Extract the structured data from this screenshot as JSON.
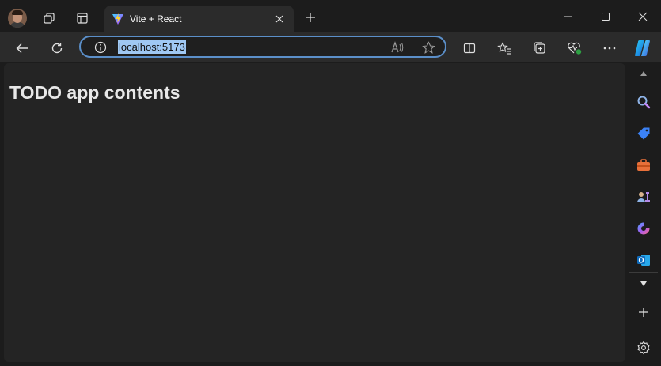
{
  "window": {
    "tab_title": "Vite + React",
    "icons": {
      "profile": "avatar",
      "workspaces": "workspaces-icon",
      "tab_actions": "tab-actions-icon",
      "favicon": "vite-icon",
      "close_tab": "close-icon",
      "new_tab": "plus-icon",
      "minimize": "minimize-icon",
      "maximize": "maximize-icon",
      "close_window": "close-icon"
    }
  },
  "toolbar": {
    "url": "localhost:5173",
    "icons": [
      "back-icon",
      "refresh-icon",
      "info-icon",
      "read-aloud-icon",
      "favorite-star-icon",
      "split-screen-icon",
      "favorites-icon",
      "collections-icon",
      "browser-essentials-icon",
      "more-icon",
      "copilot-icon"
    ]
  },
  "page": {
    "heading": "TODO app contents"
  },
  "sidebar": {
    "icons": [
      "scroll-up-icon",
      "search-icon",
      "shopping-tag-icon",
      "tools-icon",
      "games-icon",
      "microsoft-365-icon",
      "outlook-icon",
      "scroll-down-icon",
      "add-icon",
      "settings-icon"
    ]
  },
  "colors": {
    "accent": "#5b8fc9",
    "url_highlight": "#9fc8f3",
    "content_bg": "#242424",
    "chrome_bg": "#1c1c1c"
  }
}
